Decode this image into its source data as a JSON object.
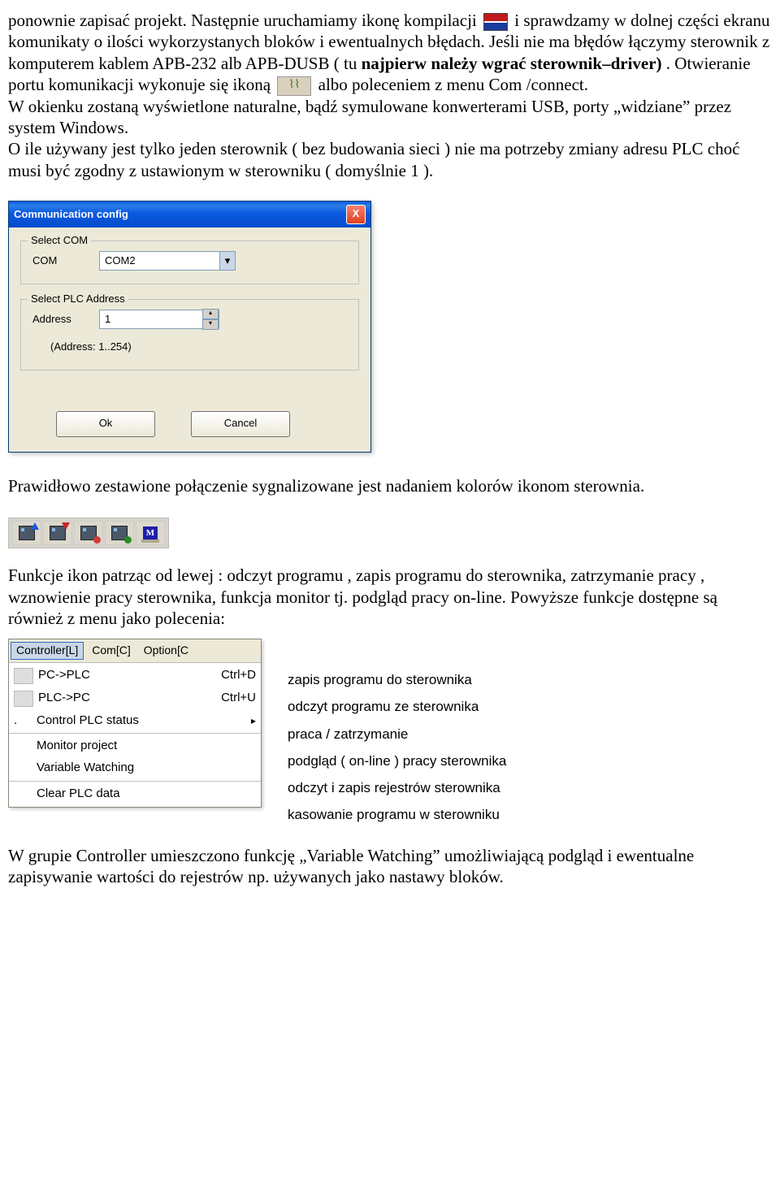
{
  "text": {
    "p1a": "ponownie zapisać projekt. Następnie uruchamiamy ikonę kompilacji ",
    "p1b": " i sprawdzamy w dolnej części ekranu komunikaty o ilości wykorzystanych bloków i ewentualnych błędach. Jeśli nie ma błędów łączymy sterownik z komputerem kablem APB-232 alb APB-DUSB ( tu ",
    "p1bold": "najpierw należy wgrać sterownik–driver)",
    "p1c": ". Otwieranie portu komunikacji wykonuje się ikoną ",
    "p1d": " albo poleceniem z menu Com /connect.",
    "p2": "W okienku zostaną wyświetlone naturalne, bądź symulowane konwerterami USB,  porty „widziane” przez system Windows.",
    "p3": "O ile używany jest tylko jeden  sterownik ( bez budowania sieci ) nie ma potrzeby zmiany adresu PLC choć musi być zgodny z  ustawionym w sterowniku ( domyślnie 1 ).",
    "p4": "Prawidłowo zestawione połączenie sygnalizowane jest nadaniem kolorów ikonom sterownia.",
    "p5": "Funkcje ikon patrząc od lewej : odczyt programu , zapis programu do sterownika, zatrzymanie pracy , wznowienie pracy sterownika, funkcja monitor tj. podgląd pracy on-line. Powyższe funkcje dostępne są również z menu  jako polecenia:",
    "p6": "W grupie  Controller umieszczono funkcję „Variable Watching” umożliwiającą podgląd i ewentualne zapisywanie wartości do rejestrów np. używanych jako nastawy bloków."
  },
  "dialog": {
    "title": "Communication config",
    "close": "X",
    "group_com": "Select COM",
    "com_label": "COM",
    "com_value": "COM2",
    "group_addr": "Select PLC Address",
    "addr_label": "Address",
    "addr_value": "1",
    "addr_hint": "(Address: 1..254)",
    "ok": "Ok",
    "cancel": "Cancel"
  },
  "menu": {
    "bar": {
      "controller": "Controller[L]",
      "com": "Com[C]",
      "option": "Option[C"
    },
    "items": [
      {
        "label": "PC->PLC",
        "shortcut": "Ctrl+D",
        "desc": "zapis programu do sterownika"
      },
      {
        "label": "PLC->PC",
        "shortcut": "Ctrl+U",
        "desc": "odczyt programu ze sterownika"
      },
      {
        "label": "Control PLC status",
        "arrow": "▸",
        "desc": "praca / zatrzymanie"
      },
      {
        "label": "Monitor project",
        "desc": "podgląd ( on-line ) pracy sterownika"
      },
      {
        "label": "Variable Watching",
        "desc": "odczyt i zapis rejestrów sterownika"
      },
      {
        "label": "Clear PLC data",
        "desc": "kasowanie programu w sterowniku"
      }
    ]
  }
}
